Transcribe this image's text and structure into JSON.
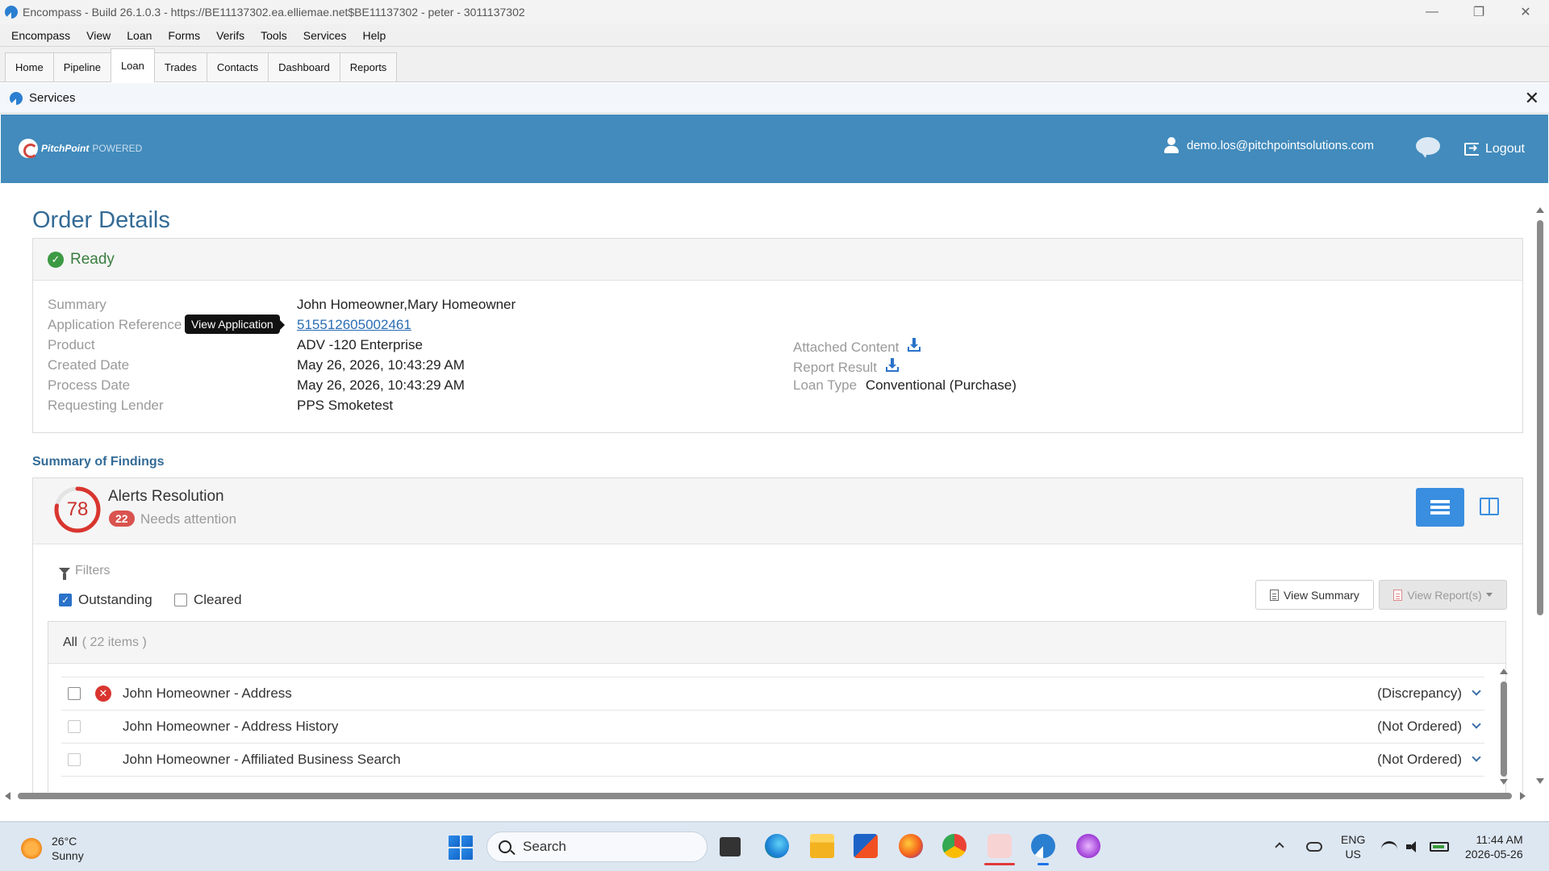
{
  "window": {
    "title": "Encompass - Build 26.1.0.3 - https://BE11137302.ea.elliemae.net$BE11137302 - peter - 3011137302",
    "controls": {
      "minimize": "—",
      "restore": "❐",
      "close": "✕"
    }
  },
  "menu": [
    "Encompass",
    "View",
    "Loan",
    "Forms",
    "Verifs",
    "Tools",
    "Services",
    "Help"
  ],
  "tabs": [
    {
      "label": "Home",
      "active": false
    },
    {
      "label": "Pipeline",
      "active": false
    },
    {
      "label": "Loan",
      "active": true
    },
    {
      "label": "Trades",
      "active": false
    },
    {
      "label": "Contacts",
      "active": false
    },
    {
      "label": "Dashboard",
      "active": false
    },
    {
      "label": "Reports",
      "active": false
    }
  ],
  "services_panel": {
    "title": "Services",
    "close": "✕"
  },
  "header": {
    "brand": "PitchPoint",
    "powered": "POWERED",
    "user_email": "demo.los@pitchpointsolutions.com",
    "logout": "Logout",
    "color": "#428bbc"
  },
  "order": {
    "title": "Order Details",
    "status": "Ready",
    "status_icon": "check-circle-icon",
    "details_left": [
      {
        "label": "Summary",
        "value": "John Homeowner,Mary Homeowner"
      },
      {
        "label": "Application Reference",
        "value": "515512605002461",
        "link": true
      },
      {
        "label": "Product",
        "value": "ADV -120 Enterprise"
      },
      {
        "label": "Created Date",
        "value": "May 26, 2026, 10:43:29 AM"
      },
      {
        "label": "Process Date",
        "value": "May 26, 2026, 10:43:29 AM"
      },
      {
        "label": "Requesting Lender",
        "value": "PPS Smoketest"
      }
    ],
    "tooltip": "View Application",
    "details_right": {
      "attached_content": "Attached Content",
      "report_result": "Report Result",
      "loan_type_label": "Loan Type",
      "loan_type_value": "Conventional (Purchase)"
    }
  },
  "findings": {
    "section_title": "Summary of Findings",
    "score": "78",
    "score_fraction": 0.78,
    "alerts_title": "Alerts Resolution",
    "needs_count": "22",
    "needs_label": "Needs attention",
    "filters_label": "Filters",
    "filter_outstanding": {
      "label": "Outstanding",
      "checked": true
    },
    "filter_cleared": {
      "label": "Cleared",
      "checked": false
    },
    "view_summary": "View Summary",
    "view_reports": "View Report(s)",
    "list_all": "All",
    "list_count": "( 22 items )",
    "items": [
      {
        "name": "John Homeowner - Address",
        "status": "(Discrepancy)",
        "alert": true
      },
      {
        "name": "John Homeowner - Address History",
        "status": "(Not Ordered)",
        "alert": false
      },
      {
        "name": "John Homeowner - Affiliated Business Search",
        "status": "(Not Ordered)",
        "alert": false
      }
    ]
  },
  "taskbar": {
    "temperature": "26°C",
    "weather": "Sunny",
    "search": "Search",
    "lang_top": "ENG",
    "lang_bottom": "US",
    "time": "11:44 AM",
    "date": "2026-05-26"
  }
}
